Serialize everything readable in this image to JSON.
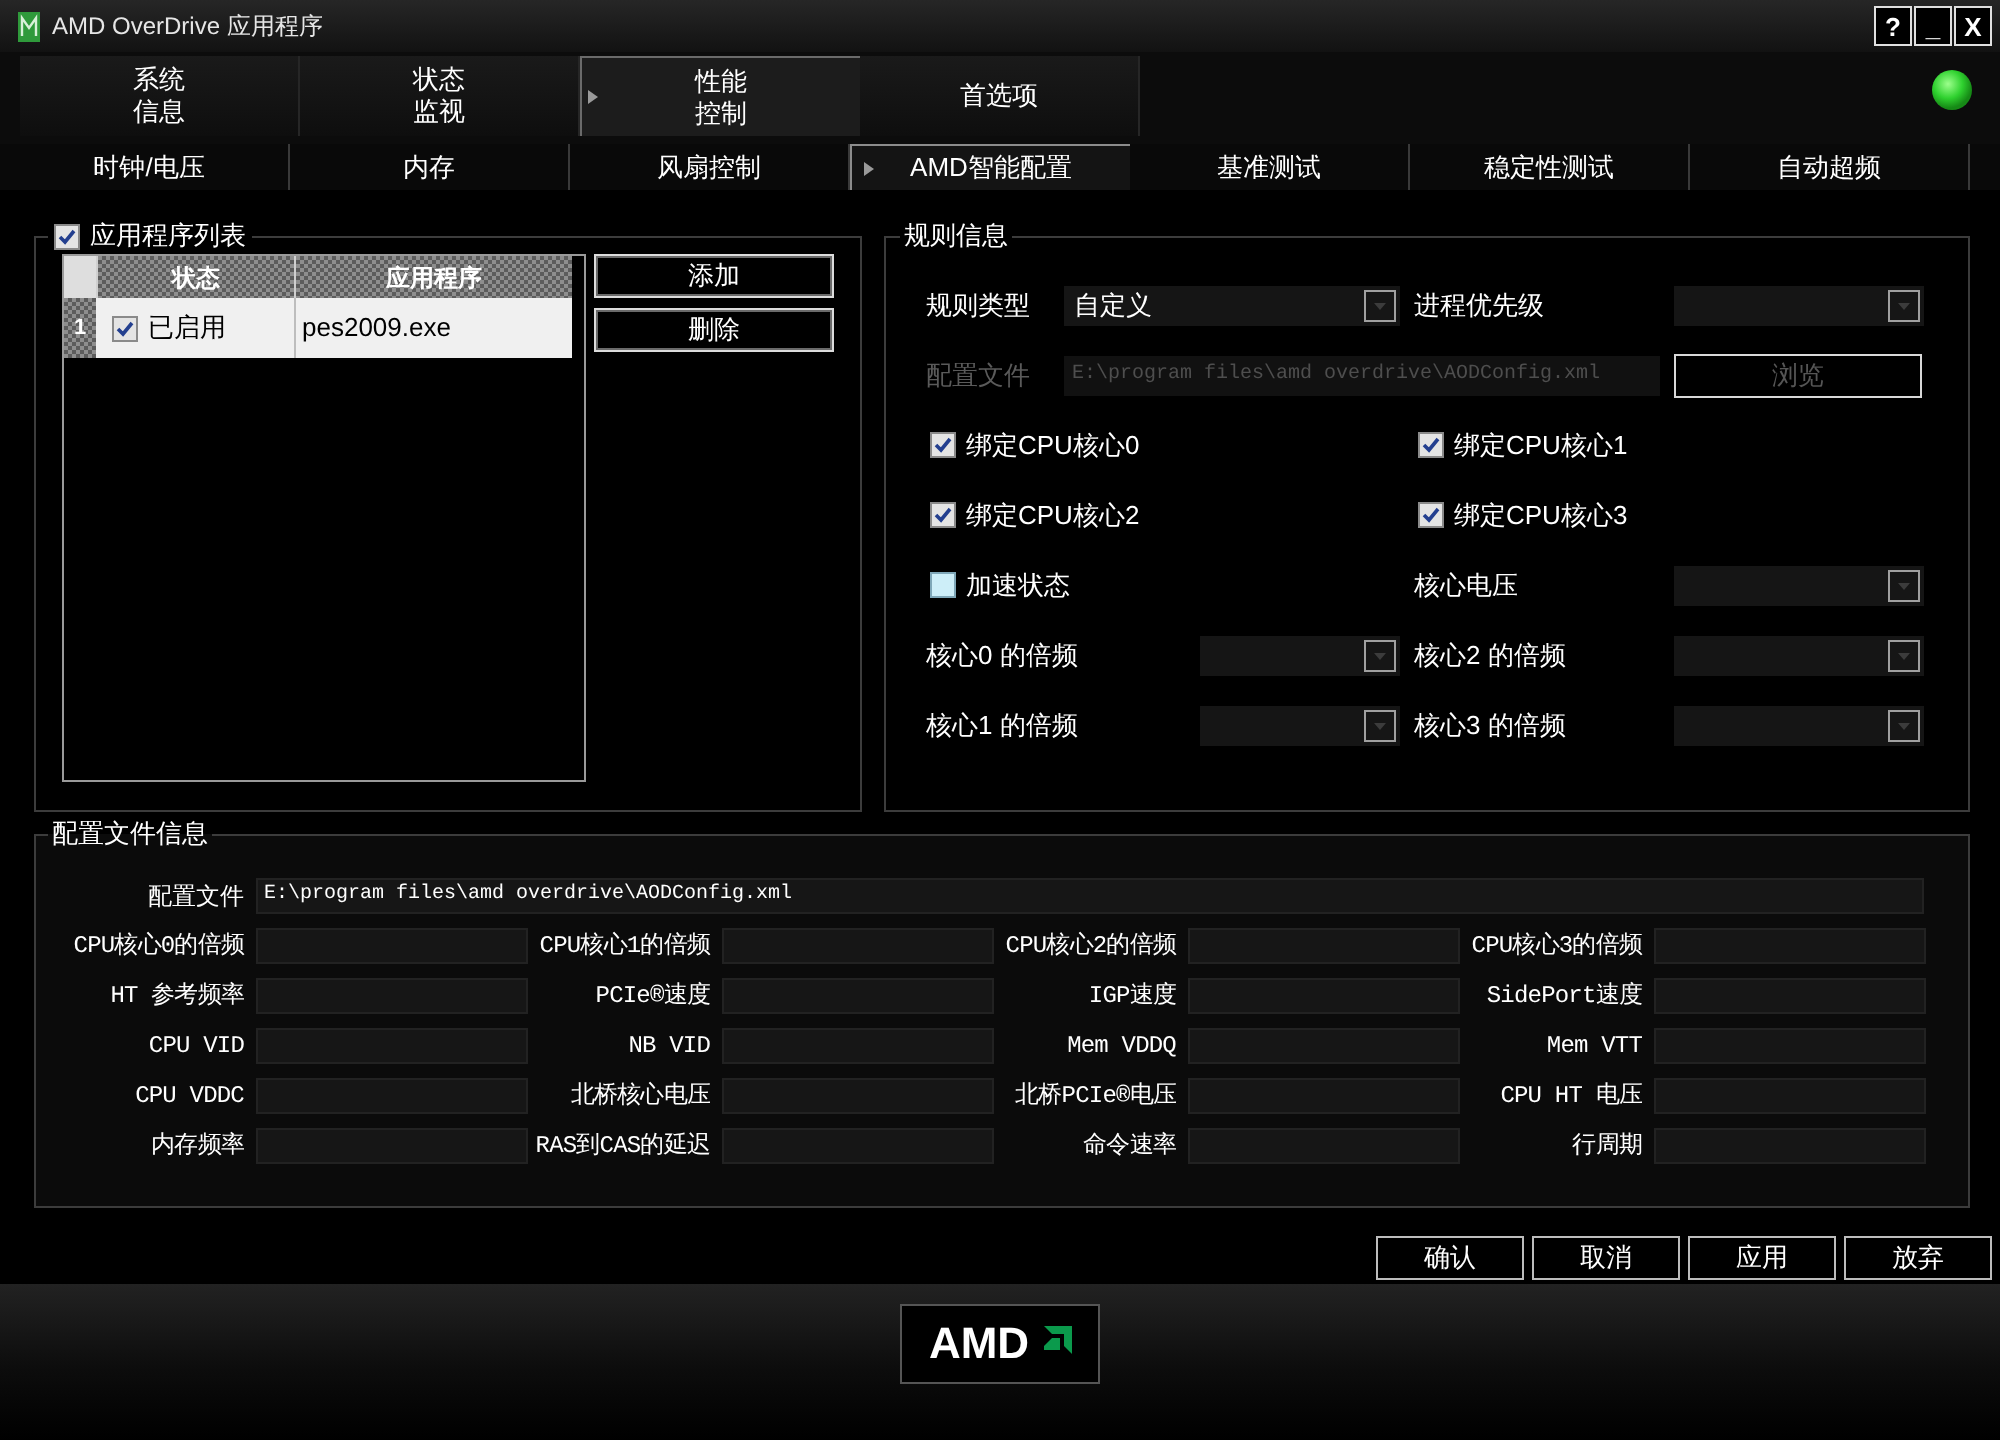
{
  "window": {
    "title": "AMD OverDrive 应用程序"
  },
  "title_buttons": [
    "?",
    "_",
    "X"
  ],
  "main_tabs": [
    {
      "lines": [
        "系统",
        "信息"
      ],
      "selected": false
    },
    {
      "lines": [
        "状态",
        "监视"
      ],
      "selected": false
    },
    {
      "lines": [
        "性能",
        "控制"
      ],
      "selected": true
    },
    {
      "lines": [
        "首选项"
      ],
      "selected": false
    }
  ],
  "sub_tabs": [
    {
      "label": "时钟/电压",
      "selected": false
    },
    {
      "label": "内存",
      "selected": false
    },
    {
      "label": "风扇控制",
      "selected": false
    },
    {
      "label": "AMD智能配置",
      "selected": true
    },
    {
      "label": "基准测试",
      "selected": false
    },
    {
      "label": "稳定性测试",
      "selected": false
    },
    {
      "label": "自动超频",
      "selected": false
    }
  ],
  "app_list": {
    "title": "应用程序列表",
    "checked": true,
    "columns": [
      "状态",
      "应用程序"
    ],
    "rows": [
      {
        "number": "1",
        "checked": true,
        "status": "已启用",
        "program": "pes2009.exe"
      }
    ],
    "buttons": [
      "添加",
      "删除"
    ]
  },
  "rule_info": {
    "title": "规则信息",
    "rule_type": {
      "label": "规则类型",
      "value": "自定义"
    },
    "process_priority": {
      "label": "进程优先级"
    },
    "config_file": {
      "label": "配置文件",
      "value": "E:\\program files\\amd overdrive\\AODConfig.xml",
      "disabled": true
    },
    "browse_button": {
      "label": "浏览",
      "disabled": true
    },
    "core_bindings": [
      {
        "label": "绑定CPU核心0",
        "checked": true
      },
      {
        "label": "绑定CPU核心1",
        "checked": true
      },
      {
        "label": "绑定CPU核心2",
        "checked": true
      },
      {
        "label": "绑定CPU核心3",
        "checked": true
      }
    ],
    "boost_state": {
      "label": "加速状态",
      "checked": false
    },
    "core_voltage": {
      "label": "核心电压"
    },
    "multipliers": [
      {
        "label": "核心0 的倍频"
      },
      {
        "label": "核心2 的倍频"
      },
      {
        "label": "核心1 的倍频"
      },
      {
        "label": "核心3 的倍频"
      }
    ]
  },
  "profile_info": {
    "title": "配置文件信息",
    "config_file": {
      "label": "配置文件",
      "value": "E:\\program files\\amd overdrive\\AODConfig.xml"
    },
    "fields": [
      {
        "label": "CPU核心0的倍频"
      },
      {
        "label": "CPU核心1的倍频"
      },
      {
        "label": "CPU核心2的倍频"
      },
      {
        "label": "CPU核心3的倍频"
      },
      {
        "label": "HT 参考频率"
      },
      {
        "label": "PCIe®速度"
      },
      {
        "label": "IGP速度"
      },
      {
        "label": "SidePort速度"
      },
      {
        "label": "CPU VID"
      },
      {
        "label": "NB VID"
      },
      {
        "label": "Mem VDDQ"
      },
      {
        "label": "Mem VTT"
      },
      {
        "label": "CPU VDDC"
      },
      {
        "label": "北桥核心电压"
      },
      {
        "label": "北桥PCIe®电压"
      },
      {
        "label": "CPU HT 电压"
      },
      {
        "label": "内存频率"
      },
      {
        "label": "RAS到CAS的延迟"
      },
      {
        "label": "命令速率"
      },
      {
        "label": "行周期"
      }
    ]
  },
  "buttons": [
    "确认",
    "取消",
    "应用",
    "放弃"
  ],
  "footer": {
    "logo_text": "AMD"
  }
}
